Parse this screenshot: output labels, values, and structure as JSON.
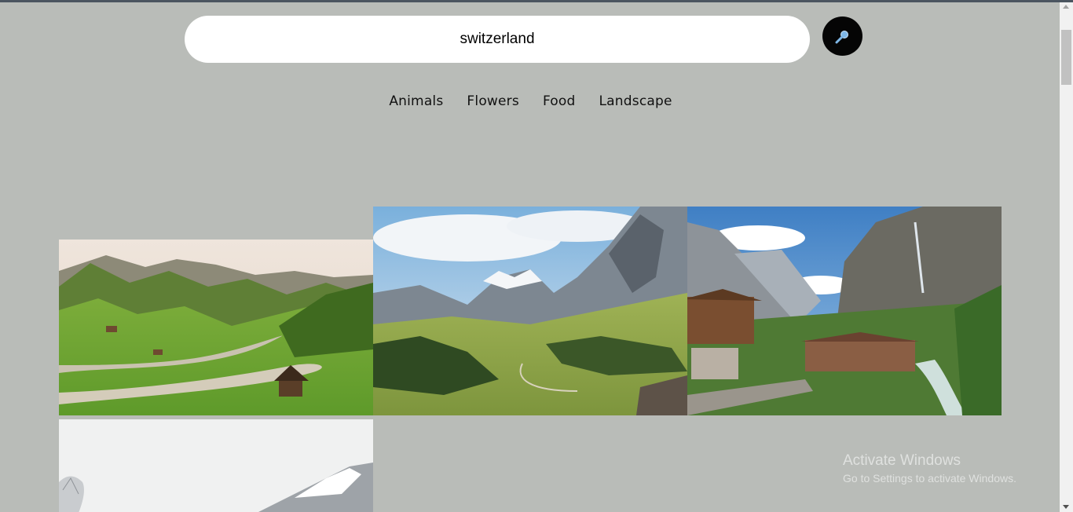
{
  "search": {
    "value": "switzerland",
    "button_icon": "search-icon"
  },
  "categories": [
    {
      "label": "Animals"
    },
    {
      "label": "Flowers"
    },
    {
      "label": "Food"
    },
    {
      "label": "Landscape"
    }
  ],
  "gallery": {
    "photos": [
      {
        "subject": "green valley with winding road and hut"
      },
      {
        "subject": "alpine meadow with rocky mountain peak"
      },
      {
        "subject": "alpine village with cliffs and waterfall"
      },
      {
        "subject": "snowy mountain with frosted trees"
      }
    ]
  },
  "watermark": {
    "title": "Activate Windows",
    "subtitle": "Go to Settings to activate Windows."
  },
  "colors": {
    "page_background": "#b9bcb8",
    "search_button": "#050505",
    "search_icon": "#7fb7e6"
  }
}
